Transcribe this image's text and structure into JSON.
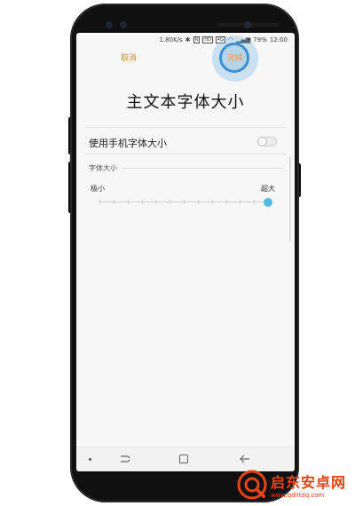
{
  "status_bar": {
    "speed": "1.80K/s",
    "badges": [
      "N",
      "HD",
      "4G"
    ],
    "battery": "79%",
    "time": "12:00"
  },
  "header": {
    "cancel_label": "取消",
    "done_label": "完成"
  },
  "page": {
    "title": "主文本字体大小"
  },
  "settings": {
    "use_phone_font_label": "使用手机字体大小",
    "use_phone_font_enabled": false,
    "font_size_section_label": "字体大小",
    "slider": {
      "min_label": "极小",
      "max_label": "超大",
      "steps": 12,
      "selected_step": 12
    }
  },
  "navigation_bar": {
    "icons": [
      "menu-dot-icon",
      "recent-apps-icon",
      "home-icon",
      "back-icon"
    ]
  },
  "watermark": {
    "name": "启东安卓网",
    "url": "www.qdlitdq.com"
  },
  "colors": {
    "accent": "#e08a2e",
    "slider_thumb": "#4fb9e4",
    "touch_indicator": "#3d8fd0",
    "watermark": "#e64410"
  }
}
